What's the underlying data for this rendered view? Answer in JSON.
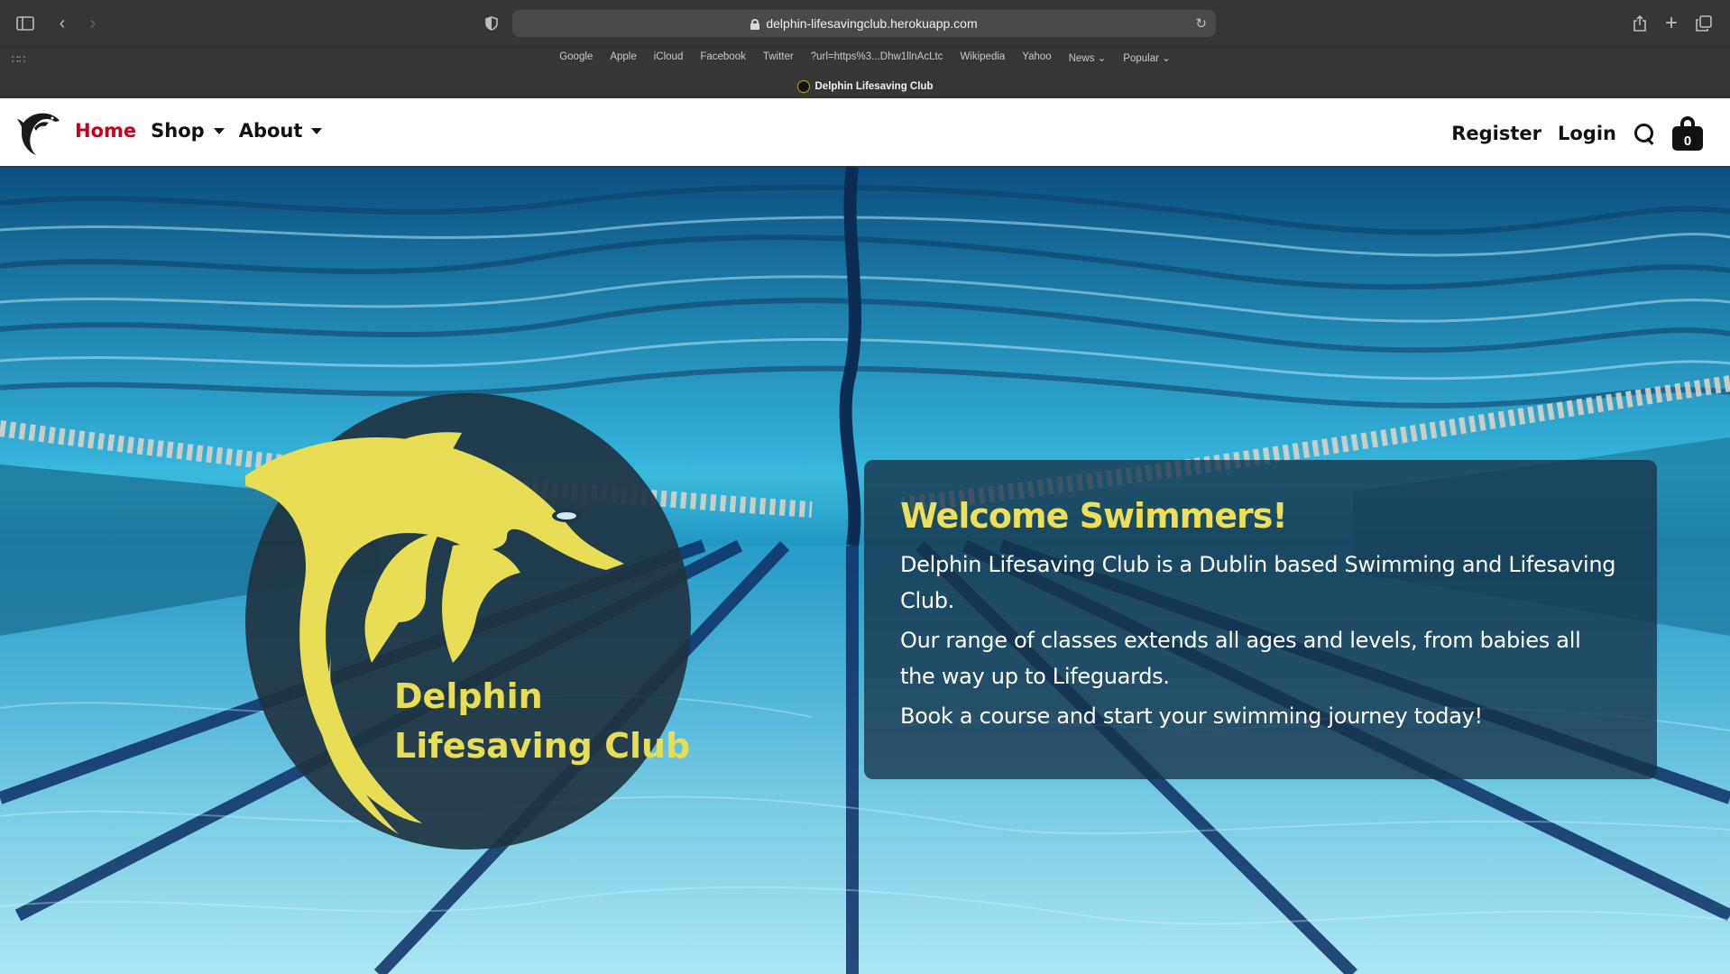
{
  "browser": {
    "url": "delphin-lifesavingclub.herokuapp.com",
    "favorites": [
      "Google",
      "Apple",
      "iCloud",
      "Facebook",
      "Twitter",
      "?url=https%3...Dhw1llnAcLtc",
      "Wikipedia",
      "Yahoo",
      "News ⌄",
      "Popular ⌄"
    ],
    "tab_title": "Delphin Lifesaving Club"
  },
  "nav": {
    "home": "Home",
    "shop": "Shop",
    "about": "About",
    "register": "Register",
    "login": "Login",
    "cart_count": "0"
  },
  "hero": {
    "logo_line1": "Delphin",
    "logo_line2": "Lifesaving Club",
    "welcome_title": "Welcome Swimmers!",
    "lines": [
      "Delphin Lifesaving Club is a Dublin based Swimming and Lifesaving Club.",
      "Our range of classes extends all ages and levels, from babies all the way up to Lifeguards.",
      "Book a course and start your swimming journey today!"
    ]
  },
  "colors": {
    "accent_yellow": "#eedf5a",
    "active_red": "#c4001a",
    "chrome_dark": "#363636"
  }
}
